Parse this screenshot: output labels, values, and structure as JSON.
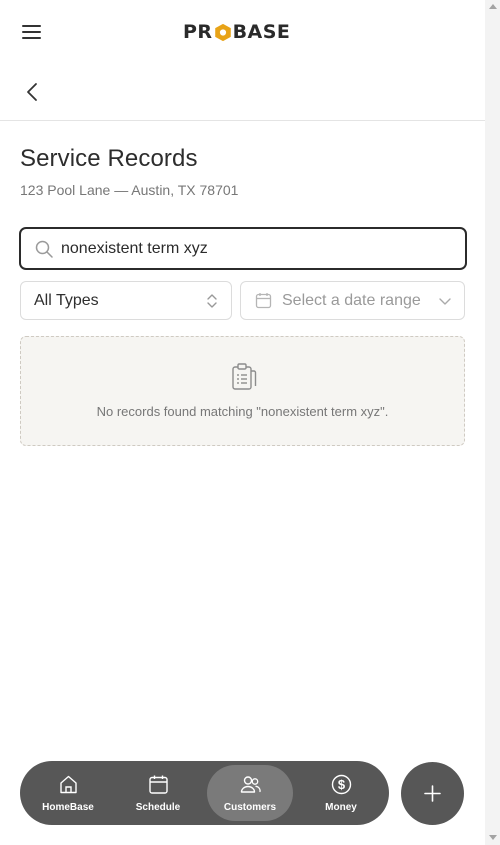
{
  "header": {
    "logo_left": "PR",
    "logo_right": "BASE",
    "brand_color": "#e8a317",
    "menu_icon": "hamburger-menu-icon"
  },
  "nav_back": {
    "icon": "chevron-left-icon"
  },
  "page": {
    "title": "Service Records",
    "address": "123 Pool Lane — Austin, TX 78701"
  },
  "search": {
    "value": "nonexistent term xyz",
    "icon": "search-icon"
  },
  "filters": {
    "type_selected": "All Types",
    "date_placeholder": "Select a date range"
  },
  "empty_state": {
    "icon": "clipboard-list-icon",
    "message": "No records found matching \"nonexistent term xyz\"."
  },
  "bottom_nav": {
    "items": [
      {
        "label": "HomeBase",
        "icon": "home-icon"
      },
      {
        "label": "Schedule",
        "icon": "calendar-icon"
      },
      {
        "label": "Customers",
        "icon": "users-icon",
        "active": true
      },
      {
        "label": "Money",
        "icon": "dollar-icon"
      }
    ],
    "fab_icon": "plus-icon"
  }
}
